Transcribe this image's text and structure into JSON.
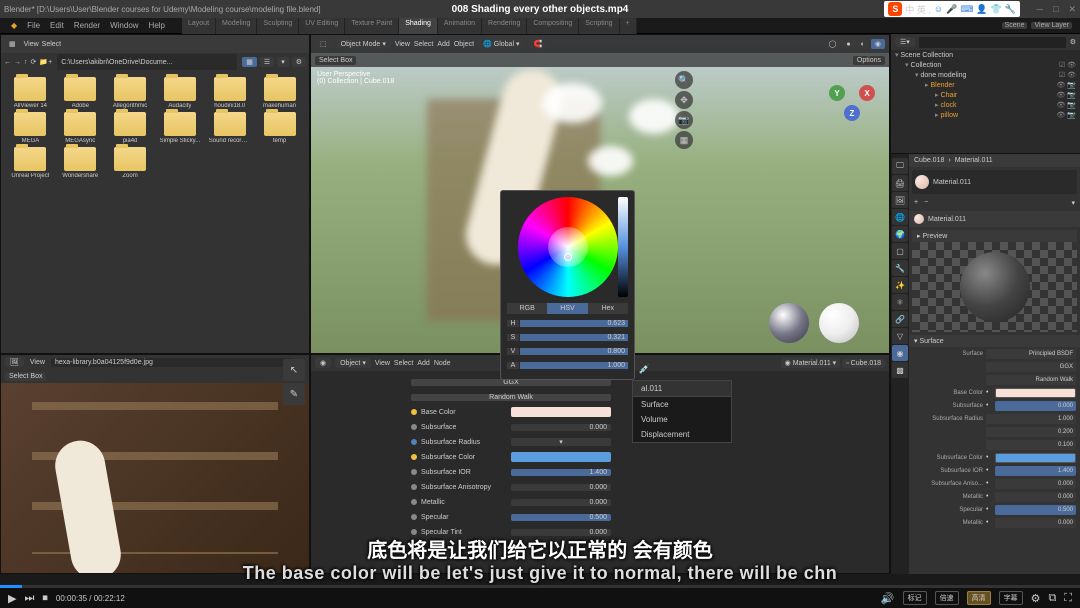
{
  "titlebar": {
    "left": "Blender* [D:\\Users\\User\\Blender courses for Udemy\\Modeling course\\modeling file.blend]",
    "center": "008 Shading every other objects.mp4",
    "sogou_label": "中 英 ,"
  },
  "menubar": [
    "File",
    "Edit",
    "Render",
    "Window",
    "Help"
  ],
  "workspaces": [
    "Layout",
    "Modeling",
    "Sculpting",
    "UV Editing",
    "Texture Paint",
    "Shading",
    "Animation",
    "Rendering",
    "Compositing",
    "Scripting",
    "+"
  ],
  "active_workspace": "Shading",
  "file_browser": {
    "path": "C:\\Users\\akibri\\OneDrive\\Docume...",
    "view_label": "View",
    "select_label": "Select",
    "folders": [
      "AllViewer 14",
      "Adobe",
      "Allegorithmic",
      "Audacity",
      "houdini18.0",
      "makehuman",
      "MEGA",
      "MEGAsync",
      "pia4d",
      "Simple Sticky...",
      "Sound recordi...",
      "temp",
      "Unreal Project",
      "Wondershare",
      "Zoom"
    ]
  },
  "image_editor": {
    "image_name": "hexa-library.b0a04125f9d0e.jpg",
    "view_label": "View",
    "select_box": "Select Box"
  },
  "viewport": {
    "select_box": "Select Box",
    "mode": "Object Mode",
    "header_items": [
      "View",
      "Select",
      "Add",
      "Object"
    ],
    "global": "Global",
    "info_line1": "User Perspective",
    "info_line2": "(0) Collection | Cube.018",
    "options": "Options"
  },
  "color_picker": {
    "tabs": [
      "RGB",
      "HSV",
      "Hex"
    ],
    "active_tab": "HSV",
    "rows": [
      {
        "l": "H",
        "v": "0.623"
      },
      {
        "l": "S",
        "v": "0.321"
      },
      {
        "l": "V",
        "v": "0.800"
      },
      {
        "l": "A",
        "v": "1.000"
      }
    ]
  },
  "surface_menu": {
    "header": "al.011",
    "items": [
      "Surface",
      "Volume",
      "Displacement"
    ]
  },
  "shader_header": {
    "items": [
      "Object",
      "View",
      "Select",
      "Add",
      "Node"
    ],
    "mat_link": "Material.011",
    "cube": "Cube.018"
  },
  "material_props": {
    "ggx": "GGX",
    "random_walk": "Random Walk",
    "rows": [
      {
        "dot": "#f0c040",
        "label": "Base Color",
        "type": "color",
        "val": "#f8e0d8"
      },
      {
        "dot": "#888",
        "label": "Subsurface",
        "type": "num",
        "val": "0.000"
      },
      {
        "dot": "#5080c0",
        "label": "Subsurface Radius",
        "type": "expand",
        "val": ""
      },
      {
        "dot": "#f0c040",
        "label": "Subsurface Color",
        "type": "color",
        "val": "#5a9ee0"
      },
      {
        "dot": "#888",
        "label": "Subsurface IOR",
        "type": "blue",
        "val": "1.400"
      },
      {
        "dot": "#888",
        "label": "Subsurface Anisotropy",
        "type": "num",
        "val": "0.000"
      },
      {
        "dot": "#888",
        "label": "Metallic",
        "type": "num",
        "val": "0.000"
      },
      {
        "dot": "#888",
        "label": "Specular",
        "type": "blue",
        "val": "0.500"
      },
      {
        "dot": "#888",
        "label": "Specular Tint",
        "type": "num",
        "val": "0.000"
      }
    ]
  },
  "outliner": {
    "search_placeholder": "",
    "view_layer": "View Layer",
    "rows": [
      {
        "indent": 0,
        "icon": "▾",
        "label": "Scene Collection",
        "icons": ""
      },
      {
        "indent": 1,
        "icon": "▾",
        "label": "Collection",
        "icons": "☑ 👁"
      },
      {
        "indent": 2,
        "icon": "▾",
        "label": "done modeling",
        "icons": "☑ 👁"
      },
      {
        "indent": 3,
        "icon": "▸",
        "label": "Blender",
        "color": "#e8a030",
        "icons": "👁 📷"
      },
      {
        "indent": 4,
        "icon": "▸",
        "label": "Chair",
        "color": "#e8a030",
        "icons": "👁 📷"
      },
      {
        "indent": 4,
        "icon": "▸",
        "label": "clock",
        "color": "#e8a030",
        "icons": "👁 📷"
      },
      {
        "indent": 4,
        "icon": "▸",
        "label": "pillow",
        "color": "#e8a030",
        "icons": "👁 📷"
      }
    ]
  },
  "props": {
    "breadcrumb1": "Cube.018",
    "breadcrumb2": "Material.011",
    "material_slot": "Material.011",
    "mat_name": "Material.011",
    "preview_label": "Preview",
    "surface_section": "Surface",
    "surface_val": "Surface",
    "bsdf": "Principled BSDF",
    "ggx": "GGX",
    "random_walk": "Random Walk",
    "rows": [
      {
        "label": "Base Color",
        "type": "color",
        "val": "#f8e0d8"
      },
      {
        "label": "Subsurface",
        "type": "blue",
        "val": "0.000"
      },
      {
        "label": "Subsurface Radius",
        "type": "multi",
        "vals": [
          "1.000",
          "0.200",
          "0.100"
        ]
      },
      {
        "label": "Subsurface Color",
        "type": "color",
        "val": "#5a9ee0"
      },
      {
        "label": "Subsurface IOR",
        "type": "blue",
        "val": "1.400"
      },
      {
        "label": "Subsurface Aniso...",
        "type": "num",
        "val": "0.000"
      },
      {
        "label": "Metallic",
        "type": "num",
        "val": "0.000"
      },
      {
        "label": "Specular",
        "type": "blue",
        "val": "0.500"
      },
      {
        "label": "Metallic",
        "type": "num",
        "val": "0.000"
      }
    ]
  },
  "video": {
    "time_current": "00:00:35",
    "time_total": "00:22:12",
    "buttons": [
      "标记",
      "倍速",
      "高清",
      "字幕"
    ],
    "subtitle_cn": "底色将是让我们给它以正常的 会有颜色",
    "subtitle_en": "The base color will be let's just give it to normal, there will be chn"
  }
}
